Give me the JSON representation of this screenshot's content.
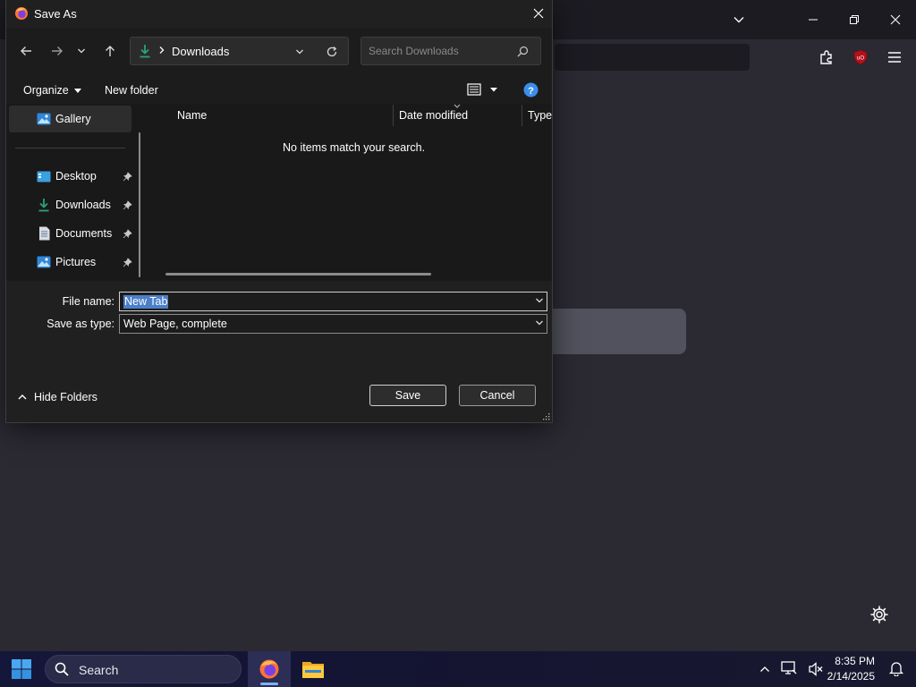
{
  "dialog": {
    "title": "Save As",
    "address": {
      "location": "Downloads"
    },
    "search_placeholder": "Search Downloads",
    "commands": {
      "organize": "Organize",
      "new_folder": "New folder"
    },
    "sidebar": {
      "items": [
        {
          "label": "Gallery",
          "icon": "gallery-icon"
        },
        {
          "label": "Desktop",
          "icon": "desktop-icon"
        },
        {
          "label": "Downloads",
          "icon": "download-icon"
        },
        {
          "label": "Documents",
          "icon": "documents-icon"
        },
        {
          "label": "Pictures",
          "icon": "pictures-icon"
        }
      ]
    },
    "columns": [
      "Name",
      "Date modified",
      "Type"
    ],
    "empty_message": "No items match your search.",
    "file_name": {
      "label": "File name:",
      "value": "New Tab"
    },
    "save_as_type": {
      "label": "Save as type:",
      "value": "Web Page, complete"
    },
    "hide_folders": "Hide Folders",
    "save_label": "Save",
    "cancel_label": "Cancel"
  },
  "taskbar": {
    "search_label": "Search",
    "time": "8:35 PM",
    "date": "2/14/2025"
  },
  "colors": {
    "accent": "#4c7fc9",
    "help": "#3b8eea",
    "download_green": "#2ea07a",
    "ublock_red": "#b0121b"
  }
}
